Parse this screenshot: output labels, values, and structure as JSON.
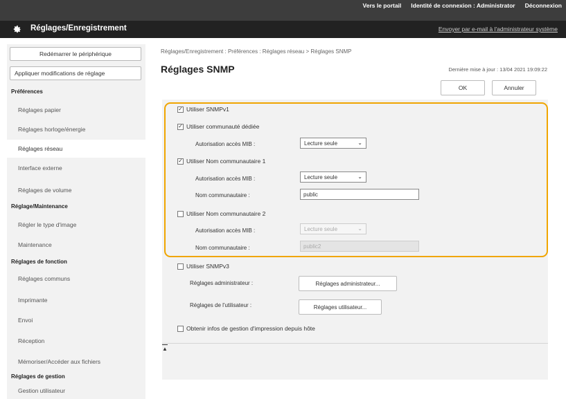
{
  "top_nav": {
    "portal": "Vers le portail",
    "login_identity": "Identité de connexion :",
    "user": "Administrator",
    "logout": "Déconnexion"
  },
  "header": {
    "title": "Réglages/Enregistrement",
    "email_link": "Envoyer par e-mail à l'administrateur système"
  },
  "sidebar": {
    "restart_button": "Redémarrer le périphérique",
    "apply_button": "Appliquer modifications de réglage",
    "sections": [
      {
        "title": "Préférences",
        "items": [
          "Réglages papier",
          "Réglages horloge/énergie",
          "Réglages réseau",
          "Interface externe",
          "Réglages de volume"
        ]
      },
      {
        "title": "Réglage/Maintenance",
        "items": [
          "Régler le type d'image",
          "Maintenance"
        ]
      },
      {
        "title": "Réglages de fonction",
        "items": [
          "Réglages communs",
          "Imprimante",
          "Envoi",
          "Réception",
          "Mémoriser/Accéder aux fichiers"
        ]
      },
      {
        "title": "Réglages de gestion",
        "items": [
          "Gestion utilisateur"
        ]
      }
    ],
    "active_item": "Réglages réseau"
  },
  "main": {
    "breadcrumb": "Réglages/Enregistrement : Préférences : Réglages réseau > Réglages SNMP",
    "title": "Réglages SNMP",
    "last_update": "Dernière mise à jour : 13/04 2021 19:09:22",
    "ok_button": "OK",
    "cancel_button": "Annuler"
  },
  "snmp": {
    "use_v1": {
      "label": "Utiliser SNMPv1",
      "checked": true
    },
    "dedicated_community": {
      "label": "Utiliser communauté dédiée",
      "checked": true
    },
    "mib_access_label": "Autorisation accès MIB :",
    "dedicated_mib_access": "Lecture seule",
    "community1": {
      "label": "Utiliser Nom communautaire 1",
      "checked": true
    },
    "community1_mib_access": "Lecture seule",
    "community_name_label": "Nom communautaire :",
    "community1_name": "public",
    "community2": {
      "label": "Utiliser Nom communautaire 2",
      "checked": false
    },
    "community2_mib_access": "Lecture seule",
    "community2_name": "public2",
    "use_v3": {
      "label": "Utiliser SNMPv3",
      "checked": false
    },
    "admin_settings_label": "Réglages administrateur :",
    "admin_settings_button": "Réglages administrateur...",
    "user_settings_label": "Réglages de l'utilisateur :",
    "user_settings_button": "Réglages utilisateur...",
    "host_info": {
      "label": "Obtenir infos de gestion d'impression depuis hôte",
      "checked": false
    }
  },
  "colors": {
    "highlight": "#f0a500",
    "header_bg": "#222222",
    "topbar_bg": "#3d3d3d"
  },
  "icons": {
    "header": "gear-icon",
    "to_top": "arrow-to-top-icon",
    "checkmark": "checkmark-icon",
    "chevron": "chevron-down-icon"
  }
}
